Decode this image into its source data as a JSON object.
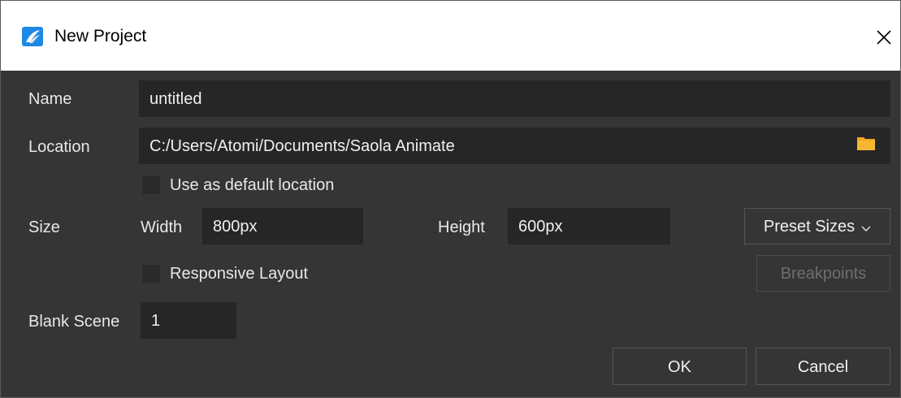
{
  "window": {
    "title": "New Project",
    "icon": "saola-animate-logo-icon",
    "close_icon": "close-icon"
  },
  "form": {
    "name_label": "Name",
    "name_value": "untitled",
    "location_label": "Location",
    "location_value": "C:/Users/Atomi/Documents/Saola Animate",
    "folder_icon": "folder-icon",
    "default_location_label": "Use as default location",
    "default_location_checked": false,
    "size_label": "Size",
    "width_label": "Width",
    "width_value": "800px",
    "height_label": "Height",
    "height_value": "600px",
    "preset_sizes_label": "Preset Sizes",
    "responsive_label": "Responsive Layout",
    "responsive_checked": false,
    "breakpoints_label": "Breakpoints",
    "blank_scene_label": "Blank Scene",
    "blank_scene_value": "1"
  },
  "actions": {
    "ok_label": "OK",
    "cancel_label": "Cancel"
  },
  "colors": {
    "accent": "#1e88e5",
    "folder": "#f5a623",
    "background": "#353535",
    "field": "#262626"
  }
}
